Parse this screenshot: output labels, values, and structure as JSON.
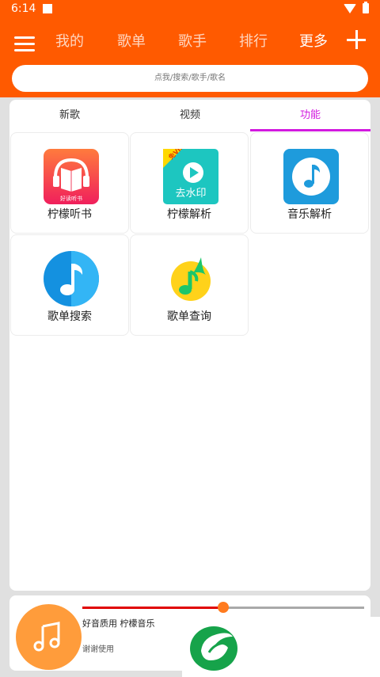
{
  "status_bar": {
    "time": "6:14"
  },
  "header": {
    "nav_tabs": [
      "我的",
      "歌单",
      "歌手",
      "排行",
      "更多"
    ],
    "active_tab_index": 4,
    "search_placeholder": "点我/搜索/歌手/歌名"
  },
  "content": {
    "tabs": [
      "新歌",
      "视频",
      "功能"
    ],
    "active_tab_index": 2,
    "tiles": [
      {
        "label": "柠檬听书",
        "icon": "headphones-book-icon"
      },
      {
        "label": "柠檬解析",
        "icon": "watermark-remove-icon"
      },
      {
        "label": "音乐解析",
        "icon": "music-note-icon"
      },
      {
        "label": "歌单搜索",
        "icon": "music-note-circle-icon"
      },
      {
        "label": "歌单查询",
        "icon": "qq-music-icon"
      }
    ],
    "tile_icon_texts": {
      "book": "好读听书",
      "badge": "免VIP",
      "watermark": "去水印"
    }
  },
  "player": {
    "title": "好音质用 柠檬音乐",
    "subtitle": "谢谢使用",
    "progress": 0.5
  },
  "colors": {
    "brand": "#ff5a00",
    "active_tab": "#d21adf",
    "progress_fill": "#e00000",
    "progress_knob": "#ff7b1f",
    "player_disc": "#ff9c3b"
  }
}
